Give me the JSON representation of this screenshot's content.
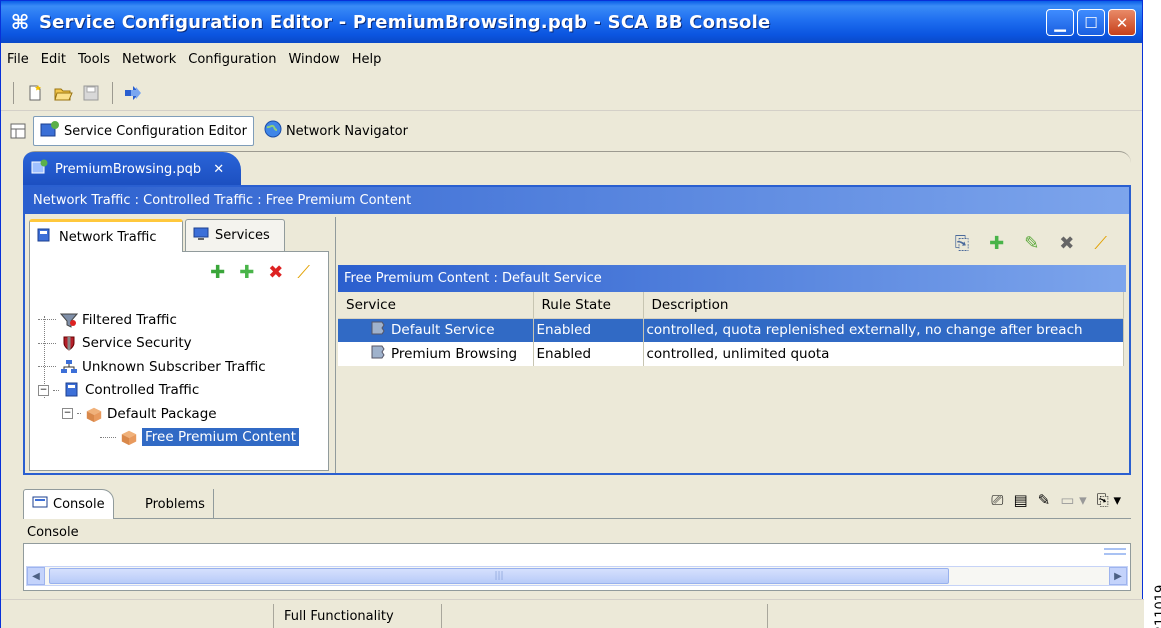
{
  "window": {
    "title": "Service Configuration Editor - PremiumBrowsing.pqb - SCA BB Console",
    "app_icon": "sca-bb-icon"
  },
  "menu": [
    "File",
    "Edit",
    "Tools",
    "Network",
    "Configuration",
    "Window",
    "Help"
  ],
  "toolbar": {
    "icons": [
      "new-file-icon",
      "open-folder-icon",
      "save-disk-icon",
      "forward-arrow-icon"
    ]
  },
  "perspectives": {
    "items": [
      {
        "label": "Service Configuration Editor",
        "icon": "editor-icon"
      },
      {
        "label": "Network Navigator",
        "icon": "globe-icon"
      }
    ]
  },
  "editor": {
    "tab_label": "PremiumBrowsing.pqb",
    "breadcrumb": "Network Traffic : Controlled Traffic : Free Premium Content"
  },
  "left_pane": {
    "tabs": [
      "Network Traffic",
      "Services"
    ],
    "tree": [
      {
        "label": "Filtered Traffic",
        "level": 0
      },
      {
        "label": "Service Security",
        "level": 0
      },
      {
        "label": "Unknown Subscriber Traffic",
        "level": 0
      },
      {
        "label": "Controlled Traffic",
        "level": 0
      },
      {
        "label": "Default Package",
        "level": 1
      },
      {
        "label": "Free Premium Content",
        "level": 2
      }
    ]
  },
  "right_pane": {
    "table_title": "Free Premium Content : Default Service",
    "columns": [
      "Service",
      "Rule State",
      "Description"
    ],
    "rows": [
      {
        "service": "Default Service",
        "state": "Enabled",
        "description": "controlled, quota replenished externally, no change after breach"
      },
      {
        "service": "Premium Browsing",
        "state": "Enabled",
        "description": "controlled, unlimited quota"
      }
    ]
  },
  "console": {
    "tabs": [
      "Console",
      "Problems"
    ],
    "label": "Console"
  },
  "statusbar": {
    "mode": "Full Functionality"
  },
  "figure_id": "211019",
  "colors": {
    "titlebar": "#0b55e0",
    "selection": "#316ac5",
    "header_gradient_start": "#2b5fce",
    "window_bg": "#ece9d8"
  }
}
